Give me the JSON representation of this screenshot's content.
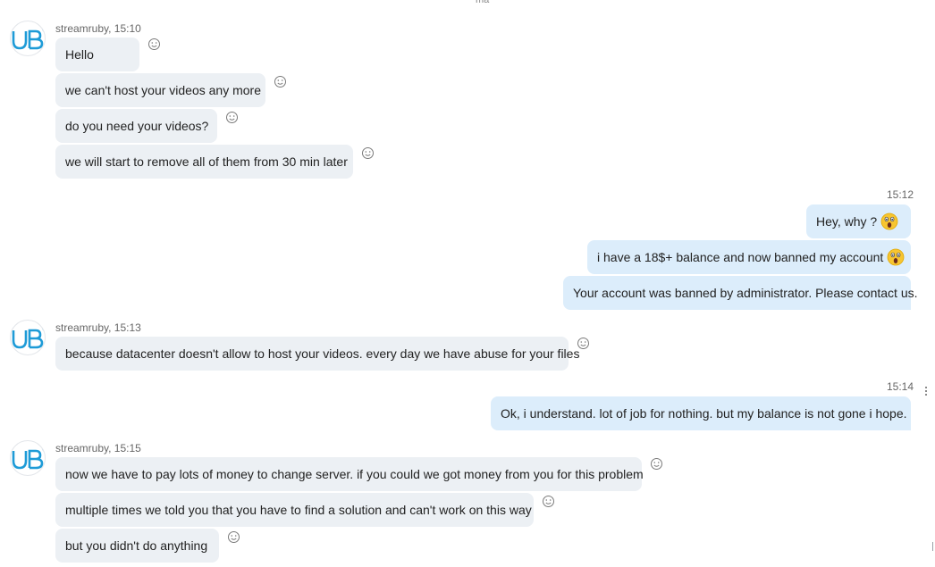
{
  "top_cut_text": "ma",
  "groups": [
    {
      "sender": "streamruby, 15:10",
      "messages": [
        "Hello",
        "we can't host your videos any more",
        "do you need your videos?",
        "we will start to remove all of them from 30 min later"
      ]
    },
    {
      "sender": "streamruby, 15:13",
      "messages": [
        "because datacenter doesn't allow to host your videos. every day we have abuse for your files"
      ]
    },
    {
      "sender": "streamruby, 15:15",
      "messages": [
        "now we have to pay lots of money to change server. if you could we got money from you for this problem",
        "multiple times we told you that you have to find a solution and can't work on this way",
        "but you didn't do anything"
      ]
    }
  ],
  "outgoing": [
    {
      "time": "15:12",
      "messages": [
        "Hey, why ?",
        "i have a 18$+ balance and now banned my account",
        "Your account was banned by administrator. Please contact us."
      ]
    },
    {
      "time": "15:14",
      "messages": [
        "Ok, i understand. lot of job for nothing. but my balance is not gone i hope."
      ]
    }
  ],
  "icons": {
    "avatar": "streamruby-logo",
    "reaction": "smiley-icon",
    "surprised": "surprised-face-emoji",
    "more": "more-options-icon"
  },
  "colors": {
    "incoming_bubble": "#ecf0f4",
    "outgoing_bubble": "#dcedfb",
    "logo_blue": "#1e9bd7"
  }
}
